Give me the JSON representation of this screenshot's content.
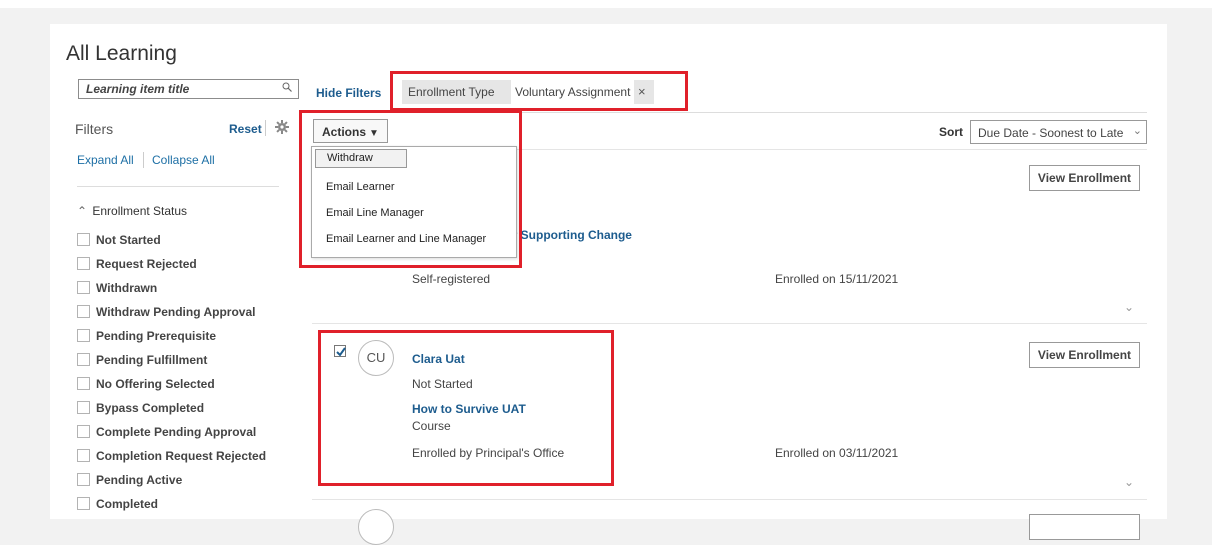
{
  "page": {
    "title": "All Learning"
  },
  "search": {
    "placeholder": "Learning item title",
    "icon": "search-icon"
  },
  "filters": {
    "title": "Filters",
    "reset_label": "Reset",
    "expand_all": "Expand All",
    "collapse_all": "Collapse All",
    "section_title": "Enrollment Status",
    "statuses": [
      "Not Started",
      "Request Rejected",
      "Withdrawn",
      "Withdraw Pending Approval",
      "Pending Prerequisite",
      "Pending Fulfillment",
      "No Offering Selected",
      "Bypass Completed",
      "Complete Pending Approval",
      "Completion Request Rejected",
      "Pending Active",
      "Completed"
    ]
  },
  "main": {
    "hide_filters": "Hide Filters",
    "chip": {
      "key": "Enrollment Type",
      "value": "Voluntary Assignment",
      "remove": "×"
    },
    "actions_label": "Actions",
    "sort_label": "Sort",
    "sort_value": "Due Date - Soonest to Late"
  },
  "actions_menu": {
    "items": [
      "Withdraw",
      "Email Learner",
      "Email Line Manager",
      "Email Learner and Line Manager"
    ]
  },
  "records": [
    {
      "view_label": "View Enrollment",
      "course_partial": "t for Supporting Change",
      "enrolled_by": "Self-registered",
      "enrolled_on": "Enrolled on 15/11/2021"
    },
    {
      "view_label": "View Enrollment",
      "initials": "CU",
      "learner": "Clara Uat",
      "status": "Not Started",
      "course": "How to Survive UAT",
      "type": "Course",
      "enrolled_by": "Enrolled by Principal's Office",
      "enrolled_on": "Enrolled on 03/11/2021",
      "checked": true
    }
  ],
  "colors": {
    "accent": "#1d5c8e",
    "highlight": "#e0202a"
  }
}
